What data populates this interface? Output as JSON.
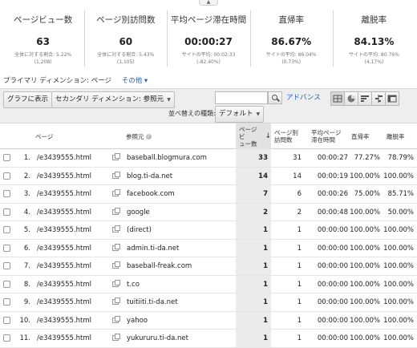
{
  "metrics": [
    {
      "label": "ページビュー数",
      "value": "63",
      "sub": "全体に対する割合: 5.22%",
      "sub2": "(1,208)"
    },
    {
      "label": "ページ別訪問数",
      "value": "60",
      "sub": "全体に対する割合: 5.43%",
      "sub2": "(1,105)"
    },
    {
      "label": "平均ページ滞在時間",
      "value": "00:00:27",
      "sub": "サイトの平均: 00:02:33",
      "sub2": "(-82.40%)"
    },
    {
      "label": "直帰率",
      "value": "86.67%",
      "sub": "サイトの平均: 86.04%",
      "sub2": "(0.73%)"
    },
    {
      "label": "離脱率",
      "value": "84.13%",
      "sub": "サイトの平均: 80.76%",
      "sub2": "(4.17%)"
    }
  ],
  "dimension": {
    "label": "プライマリ ディメンション:",
    "current": "ページ",
    "other": "その他 ▾"
  },
  "toolbar": {
    "graph_button": "グラフに表示",
    "secondary_dimension": "セカンダリ ディメンション: 参照元",
    "search_placeholder": "",
    "advance": "アドバンス",
    "sort_label": "並べ替えの種類:",
    "sort_value": "デフォルト"
  },
  "table": {
    "headers": {
      "page": "ページ",
      "referrer": "参照元",
      "pageviews_1": "ページビ",
      "pageviews_2": "ュー数",
      "sort_arrow": "↓",
      "visits_1": "ページ別",
      "visits_2": "訪問数",
      "avg_time_1": "平均ページ",
      "avg_time_2": "滞在時間",
      "bounce": "直帰率",
      "exit": "離脱率"
    },
    "rows": [
      {
        "index": "1.",
        "page": "/e3439555.html",
        "referrer": "baseball.blogmura.com",
        "pageviews": "33",
        "visits": "31",
        "avg_time": "00:00:27",
        "bounce": "77.27%",
        "exit": "78.79%"
      },
      {
        "index": "2.",
        "page": "/e3439555.html",
        "referrer": "blog.ti-da.net",
        "pageviews": "14",
        "visits": "14",
        "avg_time": "00:00:19",
        "bounce": "100.00%",
        "exit": "100.00%"
      },
      {
        "index": "3.",
        "page": "/e3439555.html",
        "referrer": "facebook.com",
        "pageviews": "7",
        "visits": "6",
        "avg_time": "00:00:26",
        "bounce": "75.00%",
        "exit": "85.71%"
      },
      {
        "index": "4.",
        "page": "/e3439555.html",
        "referrer": "google",
        "pageviews": "2",
        "visits": "2",
        "avg_time": "00:00:48",
        "bounce": "100.00%",
        "exit": "50.00%"
      },
      {
        "index": "5.",
        "page": "/e3439555.html",
        "referrer": "(direct)",
        "pageviews": "1",
        "visits": "1",
        "avg_time": "00:00:00",
        "bounce": "100.00%",
        "exit": "100.00%"
      },
      {
        "index": "6.",
        "page": "/e3439555.html",
        "referrer": "admin.ti-da.net",
        "pageviews": "1",
        "visits": "1",
        "avg_time": "00:00:00",
        "bounce": "100.00%",
        "exit": "100.00%"
      },
      {
        "index": "7.",
        "page": "/e3439555.html",
        "referrer": "baseball-freak.com",
        "pageviews": "1",
        "visits": "1",
        "avg_time": "00:00:00",
        "bounce": "100.00%",
        "exit": "100.00%"
      },
      {
        "index": "8.",
        "page": "/e3439555.html",
        "referrer": "t.co",
        "pageviews": "1",
        "visits": "1",
        "avg_time": "00:00:00",
        "bounce": "100.00%",
        "exit": "100.00%"
      },
      {
        "index": "9.",
        "page": "/e3439555.html",
        "referrer": "tuitiiti.ti-da.net",
        "pageviews": "1",
        "visits": "1",
        "avg_time": "00:00:00",
        "bounce": "100.00%",
        "exit": "100.00%"
      },
      {
        "index": "10.",
        "page": "/e3439555.html",
        "referrer": "yahoo",
        "pageviews": "1",
        "visits": "1",
        "avg_time": "00:00:00",
        "bounce": "100.00%",
        "exit": "100.00%"
      },
      {
        "index": "11.",
        "page": "/e3439555.html",
        "referrer": "yukururu.ti-da.net",
        "pageviews": "1",
        "visits": "1",
        "avg_time": "00:00:00",
        "bounce": "100.00%",
        "exit": "100.00%"
      }
    ]
  },
  "colors": {
    "link": "#2a5db0",
    "sorted_column": "#ebebeb",
    "toolbar_bg": "#eeeeee"
  }
}
